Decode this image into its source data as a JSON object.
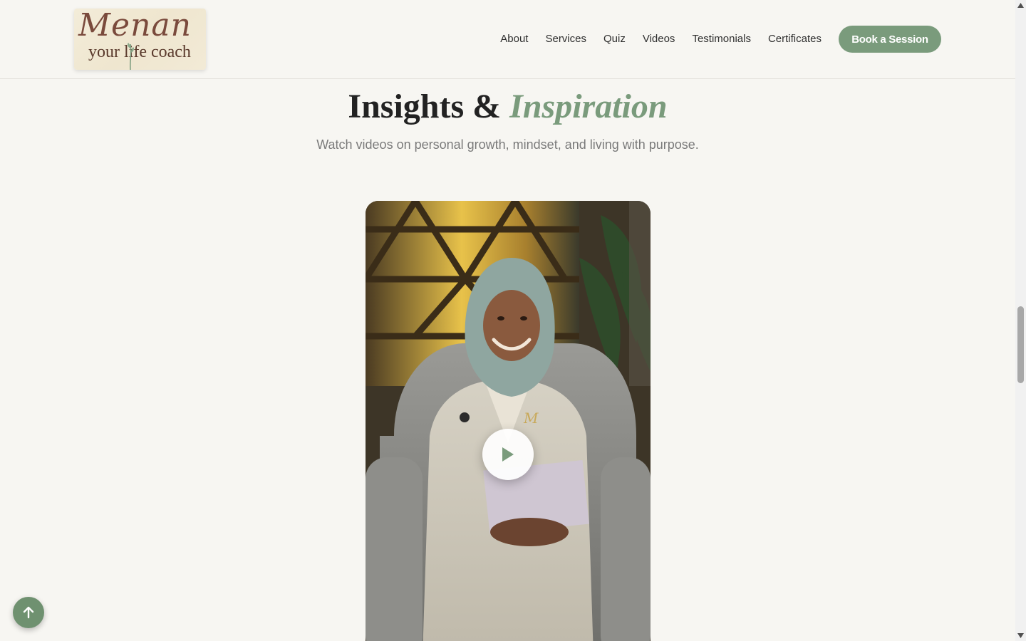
{
  "brand": {
    "logo_script": "Menan",
    "logo_tagline": "your life coach",
    "accent_color": "#7a9b7c",
    "logo_text_color": "#7a4a3c"
  },
  "nav": {
    "items": [
      "About",
      "Services",
      "Quiz",
      "Videos",
      "Testimonials",
      "Certificates"
    ],
    "cta": "Book a Session"
  },
  "section": {
    "title_main": "Insights &",
    "title_accent": "Inspiration",
    "subtitle": "Watch videos on personal growth, mindset, and living with purpose."
  },
  "video": {
    "play_icon": "play-icon"
  },
  "controls": {
    "back_to_top_icon": "arrow-up-icon"
  }
}
